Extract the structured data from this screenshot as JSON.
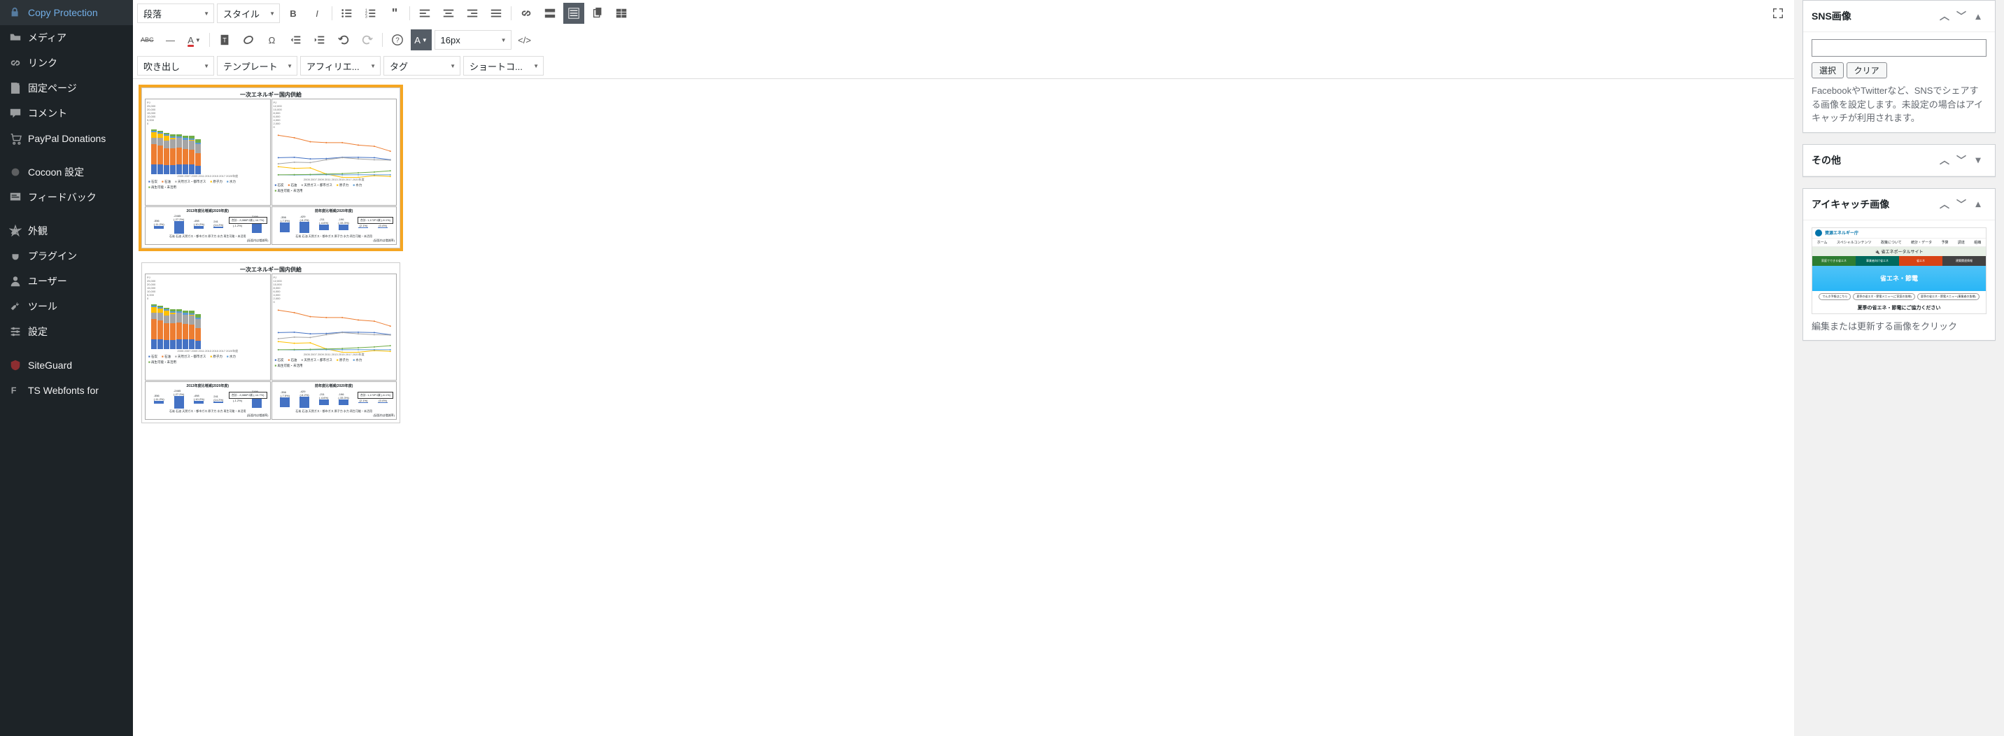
{
  "sidebar": {
    "items": [
      {
        "icon": "lock",
        "label": "Copy Protection"
      },
      {
        "icon": "media",
        "label": "メディア"
      },
      {
        "icon": "link",
        "label": "リンク"
      },
      {
        "icon": "page",
        "label": "固定ページ"
      },
      {
        "icon": "comment",
        "label": "コメント"
      },
      {
        "icon": "cart",
        "label": "PayPal Donations"
      },
      {
        "icon": "circle",
        "label": "Cocoon 設定",
        "spacer_before": true
      },
      {
        "icon": "feedback",
        "label": "フィードバック"
      },
      {
        "icon": "appearance",
        "label": "外観",
        "spacer_before": true
      },
      {
        "icon": "plugin",
        "label": "プラグイン"
      },
      {
        "icon": "user",
        "label": "ユーザー"
      },
      {
        "icon": "tool",
        "label": "ツール"
      },
      {
        "icon": "settings",
        "label": "設定"
      },
      {
        "icon": "shield",
        "label": "SiteGuard",
        "spacer_before": true
      },
      {
        "icon": "font",
        "label": "TS Webfonts for"
      }
    ]
  },
  "toolbar": {
    "row1": {
      "paragraph": "段落",
      "style": "スタイル",
      "fontsize": "16px"
    },
    "row2": {
      "abc": "ABC"
    },
    "row3": {
      "fukidashi": "吹き出し",
      "template": "テンプレート",
      "affiliate": "アフィリエ...",
      "tag": "タグ",
      "shortcode": "ショートコ..."
    }
  },
  "right": {
    "panel1": {
      "title": "SNS画像",
      "select_btn": "選択",
      "clear_btn": "クリア",
      "desc": "FacebookやTwitterなど、SNSでシェアする画像を設定します。未設定の場合はアイキャッチが利用されます。"
    },
    "panel2": {
      "title": "その他"
    },
    "panel3": {
      "title": "アイキャッチ画像",
      "thumb": {
        "agency": "資源エネルギー庁",
        "portal_bar": "🔌 省エネポータルサイト",
        "tiles": [
          "家庭でできる省エネ",
          "事業者向け省エネ",
          "省エネ",
          "建築関連情報"
        ],
        "hero": "省エネ・節電",
        "pills": [
          "でんき予報はこちら",
          "夏季の省エネ・節電メニュー(ご家庭の皆様)",
          "夏季の省エネ・節電メニュー(事業者の皆様)"
        ],
        "caption": "夏季の省エネ・節電にご協力ください"
      },
      "hint": "編集または更新する画像をクリック"
    }
  },
  "chart_data": [
    {
      "type": "bar",
      "title": "一次エネルギー国内供給",
      "ylabel": "PJ",
      "ylim": [
        0,
        25000
      ],
      "categories": [
        "2005",
        "2007",
        "2009",
        "2011",
        "2013",
        "2015",
        "2017",
        "2020年度"
      ],
      "series": [
        {
          "name": "石炭",
          "values": [
            4900,
            5000,
            4600,
            4700,
            5000,
            5000,
            4900,
            4400
          ]
        },
        {
          "name": "石油",
          "values": [
            10400,
            9800,
            8800,
            8600,
            8600,
            8000,
            7700,
            6500
          ]
        },
        {
          "name": "天然ガス・都市ガス",
          "values": [
            3400,
            3800,
            3700,
            4400,
            4900,
            4600,
            4400,
            4300
          ]
        },
        {
          "name": "原子力",
          "values": [
            2700,
            2300,
            2400,
            900,
            80,
            80,
            500,
            300
          ]
        },
        {
          "name": "水力",
          "values": [
            700,
            660,
            700,
            730,
            700,
            730,
            700,
            700
          ]
        },
        {
          "name": "再生可能・未活用",
          "values": [
            700,
            750,
            800,
            900,
            1000,
            1200,
            1400,
            1700
          ]
        }
      ],
      "legend": [
        "石炭",
        "石油",
        "天然ガス・都市ガス",
        "原子力",
        "水力",
        "再生可能・未活用"
      ]
    },
    {
      "type": "line",
      "title": "一次エネルギー国内供給",
      "ylabel": "PJ",
      "ylim": [
        0,
        12000
      ],
      "x": [
        "2005",
        "2007",
        "2009",
        "2011",
        "2013",
        "2015",
        "2017",
        "2020年度"
      ],
      "series": [
        {
          "name": "石炭",
          "values": [
            4900,
            5000,
            4600,
            4700,
            5000,
            5000,
            4900,
            4400
          ]
        },
        {
          "name": "石油",
          "values": [
            10400,
            9800,
            8800,
            8600,
            8600,
            8000,
            7700,
            6500
          ]
        },
        {
          "name": "天然ガス・都市ガス",
          "values": [
            3400,
            3800,
            3700,
            4400,
            4900,
            4600,
            4400,
            4300
          ]
        },
        {
          "name": "原子力",
          "values": [
            2700,
            2300,
            2400,
            900,
            80,
            80,
            500,
            300
          ]
        },
        {
          "name": "水力",
          "values": [
            700,
            660,
            700,
            730,
            700,
            730,
            700,
            700
          ]
        },
        {
          "name": "再生可能・未活用",
          "values": [
            700,
            750,
            800,
            900,
            1000,
            1200,
            1400,
            1700
          ]
        }
      ],
      "legend": [
        "石炭",
        "石油",
        "天然ガス・都市ガス",
        "原子力",
        "水力",
        "再生可能・未活用"
      ]
    },
    {
      "type": "bar",
      "title": "2013年度比増減(2020年度)",
      "ylabel": "PJ",
      "ylim": [
        -3000,
        1000
      ],
      "categories": [
        "石炭",
        "石油",
        "天然ガス・都市ガス",
        "原子力",
        "水力",
        "再生可能・未活用"
      ],
      "values": [
        -556,
        -2465,
        -498,
        241,
        -9,
        2199
      ],
      "pct_labels": [
        "(-11.2%)",
        "(-27.2%)",
        "(-10.2%)",
        "(14.2%)",
        "(-1.2%)",
        "(58.4%)"
      ],
      "summary": "合計: -3,088PJ減 (-14.7%)",
      "note": "(括弧内は増減率)"
    },
    {
      "type": "bar",
      "title": "前年度比増減(2020年度)",
      "ylabel": "PJ",
      "ylim": [
        -600,
        200
      ],
      "categories": [
        "石炭",
        "石油",
        "天然ガス・都市ガス",
        "原子力",
        "水力",
        "再生可能・未活用"
      ],
      "values": [
        -356,
        -429,
        -211,
        -196,
        15,
        5
      ],
      "pct_labels": [
        "(-7.5%)",
        "(-6.2%)",
        "(-4.6%)",
        "(-33.3%)",
        "(2.1%)",
        "(0.4%)"
      ],
      "summary": "合計: 1,172PJ減 (-6.1%)",
      "note": "(括弧内は増減率)"
    }
  ]
}
